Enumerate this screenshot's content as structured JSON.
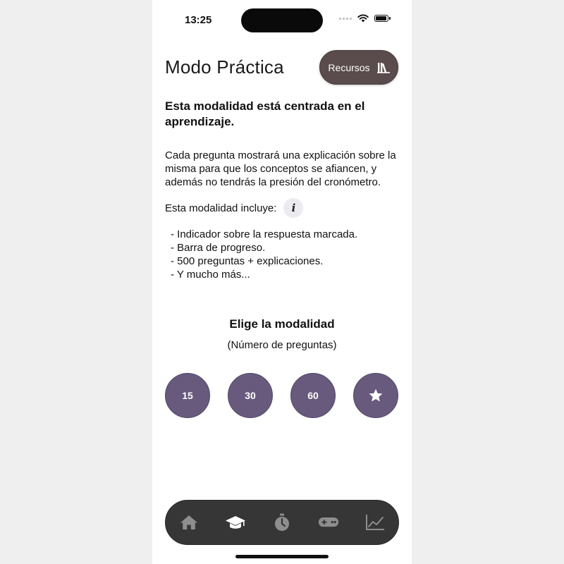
{
  "status_bar": {
    "time": "13:25"
  },
  "header": {
    "title": "Modo Práctica",
    "resources_label": "Recursos"
  },
  "content": {
    "subtitle": "Esta modalidad está centrada en el aprendizaje.",
    "description": "Cada pregunta mostrará una explicación sobre la misma para que los conceptos se afiancen, y además no tendrás la presión del cronómetro.",
    "includes_label": "Esta modalidad incluye:",
    "features": [
      "- Indicador sobre la respuesta marcada.",
      "- Barra de progreso.",
      "- 500 preguntas + explicaciones.",
      "- Y mucho más..."
    ]
  },
  "modality": {
    "title": "Elige la modalidad",
    "subtitle": "(Número de preguntas)",
    "options": [
      "15",
      "30",
      "60"
    ],
    "favorites_icon": "star-icon"
  },
  "tabbar": {
    "tabs": [
      {
        "icon": "home-icon",
        "active": false
      },
      {
        "icon": "graduation-cap-icon",
        "active": true
      },
      {
        "icon": "stopwatch-icon",
        "active": false
      },
      {
        "icon": "gamepad-icon",
        "active": false
      },
      {
        "icon": "chart-line-icon",
        "active": false
      }
    ]
  },
  "colors": {
    "resources_button": "#5a4b4c",
    "mode_button": "#675a7c",
    "tabbar_background": "#363636",
    "tab_active": "#ffffff",
    "tab_inactive": "#8e8e8e"
  }
}
